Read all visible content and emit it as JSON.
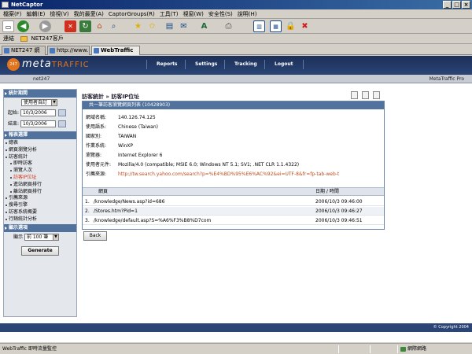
{
  "window": {
    "title": "NetCaptor"
  },
  "menu": [
    "檔案(F)",
    "編輯(E)",
    "檢視(V)",
    "我的最愛(A)",
    "CaptorGroups(R)",
    "工具(T)",
    "視窗(W)",
    "安全性(S)",
    "說明(H)"
  ],
  "toolbar": {
    "icons": [
      "new-icon",
      "back-icon",
      "forward-icon",
      "stop-icon",
      "refresh-icon",
      "home-icon",
      "search-icon",
      "favorites-icon",
      "add-favorite-icon",
      "history-icon",
      "mail-icon",
      "font-icon",
      "print-icon",
      "panel-icon",
      "tile-icon",
      "lock-icon",
      "close-icon"
    ]
  },
  "links_bar": {
    "label": "連結",
    "item": "NET247客戶"
  },
  "tabs": [
    {
      "label": "NET247 網"
    },
    {
      "label": "http://www."
    },
    {
      "label": "WebTraffic"
    }
  ],
  "site": {
    "logo_circle": "247",
    "logo_meta": "meta",
    "logo_traffic": "TRAFFIC",
    "nav": [
      "Reports",
      "Settings",
      "Tracking",
      "Logout"
    ],
    "user": "net247",
    "brand": "MetaTraffic Pro",
    "footer": "© Copyright 2004"
  },
  "sidebar": {
    "date_section": "統計期間",
    "range_value": "使用者自訂",
    "start_label": "起始:",
    "start_date": "10/3/2006",
    "end_label": "結束:",
    "end_date": "10/3/2006",
    "report_section": "報表選擇",
    "items": [
      {
        "label": "總表",
        "level": 1
      },
      {
        "label": "網頁瀏覽分析",
        "level": 1
      },
      {
        "label": "訪客統計",
        "level": 1
      },
      {
        "label": "即時訪客",
        "level": 2
      },
      {
        "label": "瀏覽人次",
        "level": 2
      },
      {
        "label": "訪客IP位址",
        "level": 2,
        "active": true
      },
      {
        "label": "進站網頁排行",
        "level": 2
      },
      {
        "label": "離站網頁排行",
        "level": 2
      },
      {
        "label": "引薦來源",
        "level": 1
      },
      {
        "label": "搜尋引擎",
        "level": 1
      },
      {
        "label": "訪客系統概要",
        "level": 1
      },
      {
        "label": "行銷統計分析",
        "level": 1
      }
    ],
    "display_section": "顯示選項",
    "display_label": "顯示",
    "display_value": "前 100 筆",
    "generate": "Generate"
  },
  "content": {
    "breadcrumb": "訪客統計 » 訪客IP位址",
    "panel_title": "共一筆訪客瀏覽網頁列表 (10428903)",
    "info": [
      {
        "label": "網域名稱:",
        "value": "140.126.74.125"
      },
      {
        "label": "使用語系:",
        "value": "Chinese (Taiwan)"
      },
      {
        "label": "國家別:",
        "value": "TAIWAN"
      },
      {
        "label": "作業系統:",
        "value": "WinXP"
      },
      {
        "label": "瀏覽器:",
        "value": "Internet Explorer 6"
      },
      {
        "label": "使用者元件:",
        "value": "Mozilla/4.0 (compatible; MSIE 6.0; Windows NT 5.1; SV1; .NET CLR 1.1.4322)"
      },
      {
        "label": "引薦來源:",
        "value": "http://tw.search.yahoo.com/search?p=%E4%BD%95%E6%AC%92&ei=UTF-8&fr=fp-tab-web-t",
        "link": true
      }
    ],
    "table_headers": {
      "page": "網頁",
      "date": "日期 / 時間"
    },
    "rows": [
      {
        "n": "1.",
        "page": "/knowledge/News.asp?id=686",
        "date": "2006/10/3 09:46:00"
      },
      {
        "n": "2.",
        "page": "/Stores.htm?Pid=1",
        "date": "2006/10/3 09:46:27"
      },
      {
        "n": "3.",
        "page": "/knowledge/default.asp?S=%A6%F3%B8%D7com",
        "date": "2006/10/3 09:46:51"
      }
    ],
    "back": "Back"
  },
  "status": {
    "text": "WebTraffic 即時流量監控",
    "zone": "網際網路"
  }
}
